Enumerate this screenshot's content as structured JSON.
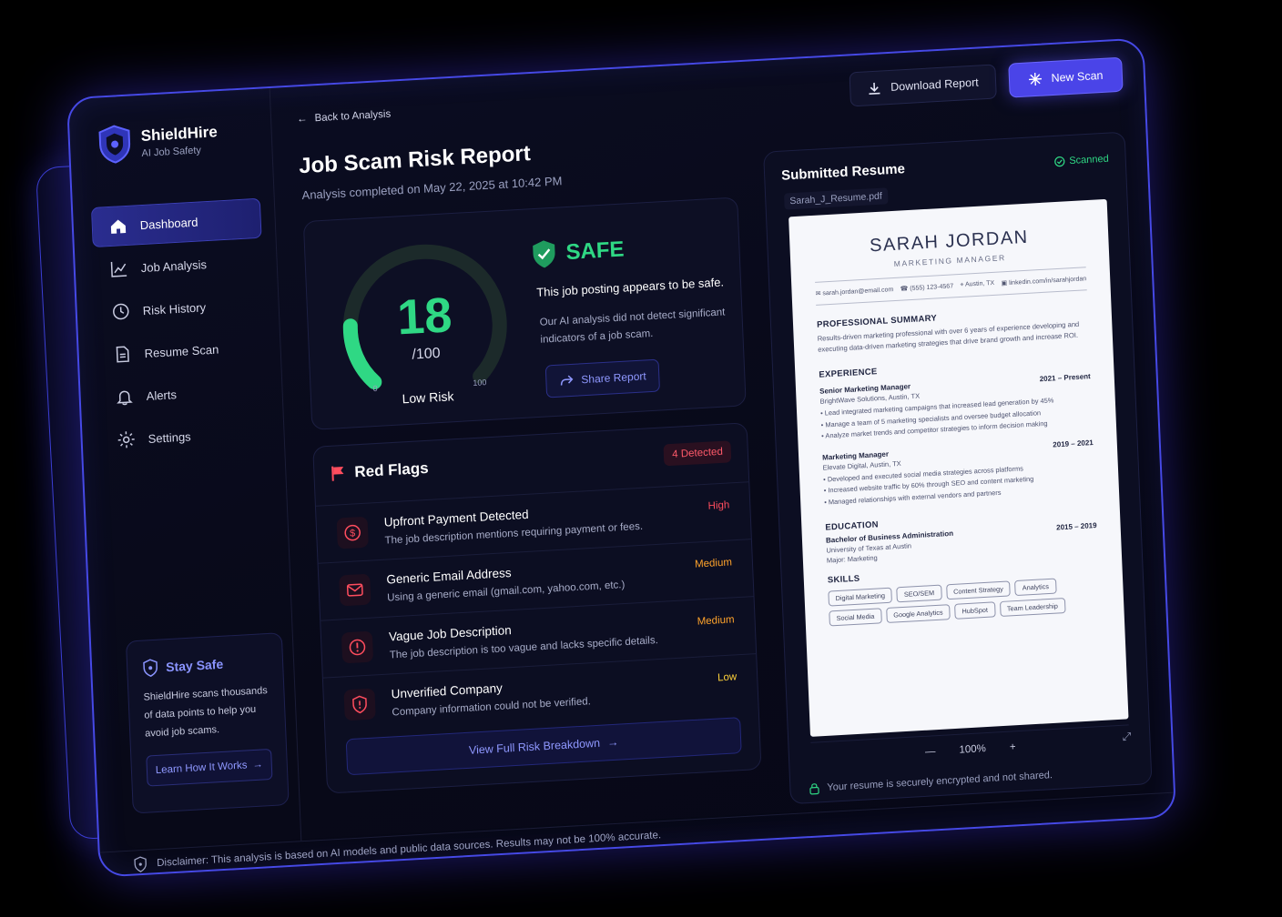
{
  "brand": {
    "name": "ShieldHire",
    "tagline": "AI Job Safety"
  },
  "nav": [
    {
      "label": "Dashboard",
      "icon": "home-icon",
      "active": true
    },
    {
      "label": "Job Analysis",
      "icon": "chart-line-icon"
    },
    {
      "label": "Risk History",
      "icon": "clock-icon"
    },
    {
      "label": "Resume Scan",
      "icon": "document-icon"
    },
    {
      "label": "Alerts",
      "icon": "bell-icon"
    },
    {
      "label": "Settings",
      "icon": "gear-icon"
    }
  ],
  "stay_safe": {
    "title": "Stay Safe",
    "text": "ShieldHire scans thousands of data points to help you avoid job scams.",
    "button": "Learn How It Works"
  },
  "header": {
    "back": "Back to Analysis",
    "title": "Job Scam Risk Report",
    "subtitle": "Analysis completed on May 22, 2025 at 10:42 PM",
    "download": "Download Report",
    "new_scan": "New Scan"
  },
  "score": {
    "value": "18",
    "max": "/100",
    "fraction": 0.18,
    "min_label": "0",
    "max_label": "100",
    "label": "Low Risk",
    "verdict": "SAFE",
    "verdict_main": "This job posting appears to be safe.",
    "verdict_desc": "Our AI analysis did not detect significant indicators of a job scam.",
    "share": "Share Report"
  },
  "red_flags": {
    "title": "Red Flags",
    "count": "4 Detected",
    "items": [
      {
        "title": "Upfront Payment Detected",
        "desc": "The job description mentions requiring payment or fees.",
        "severity": "High",
        "icon": "dollar-circle-icon"
      },
      {
        "title": "Generic Email Address",
        "desc": "Using a generic email (gmail.com, yahoo.com, etc.)",
        "severity": "Medium",
        "icon": "mail-icon"
      },
      {
        "title": "Vague Job Description",
        "desc": "The job description is too vague and lacks specific details.",
        "severity": "Medium",
        "icon": "alert-circle-icon"
      },
      {
        "title": "Unverified Company",
        "desc": "Company information could not be verified.",
        "severity": "Low",
        "icon": "shield-alert-icon"
      }
    ],
    "full_button": "View Full Risk Breakdown"
  },
  "resume": {
    "title": "Submitted Resume",
    "file": "Sarah_J_Resume.pdf",
    "status": "Scanned",
    "name": "SARAH JORDAN",
    "role": "MARKETING MANAGER",
    "email": "sarah.jordan@email.com",
    "phone": "(555) 123-4567",
    "location": "Austin, TX",
    "linkedin": "linkedin.com/in/sarahjordan",
    "summary_title": "PROFESSIONAL SUMMARY",
    "summary": "Results-driven marketing professional with over 6 years of experience developing and executing data-driven marketing strategies that drive brand growth and increase ROI.",
    "experience_title": "EXPERIENCE",
    "jobs": [
      {
        "title": "Senior Marketing Manager",
        "dates": "2021 – Present",
        "company": "BrightWave Solutions, Austin, TX",
        "bullets": [
          "Lead integrated marketing campaigns that increased lead generation by 45%",
          "Manage a team of 5 marketing specialists and oversee budget allocation",
          "Analyze market trends and competitor strategies to inform decision making"
        ]
      },
      {
        "title": "Marketing Manager",
        "dates": "2019 – 2021",
        "company": "Elevate Digital, Austin, TX",
        "bullets": [
          "Developed and executed social media strategies across platforms",
          "Increased website traffic by 60% through SEO and content marketing",
          "Managed relationships with external vendors and partners"
        ]
      }
    ],
    "education_title": "EDUCATION",
    "degree": "Bachelor of Business Administration",
    "degree_dates": "2015 – 2019",
    "school": "University of Texas at Austin",
    "major": "Major: Marketing",
    "skills_title": "SKILLS",
    "skills": [
      "Digital Marketing",
      "SEO/SEM",
      "Content Strategy",
      "Analytics",
      "Social Media",
      "Google Analytics",
      "HubSpot",
      "Team Leadership"
    ],
    "zoom": "100%",
    "note": "Your resume is securely encrypted and not shared."
  },
  "disclaimer": "Disclaimer: This analysis is based on AI models and public data sources. Results may not be 100% accurate.",
  "colors": {
    "accent": "#4a44e8",
    "safe": "#2fd884",
    "high": "#ff4d5e",
    "medium": "#ffa32b",
    "low": "#ffd23a"
  }
}
